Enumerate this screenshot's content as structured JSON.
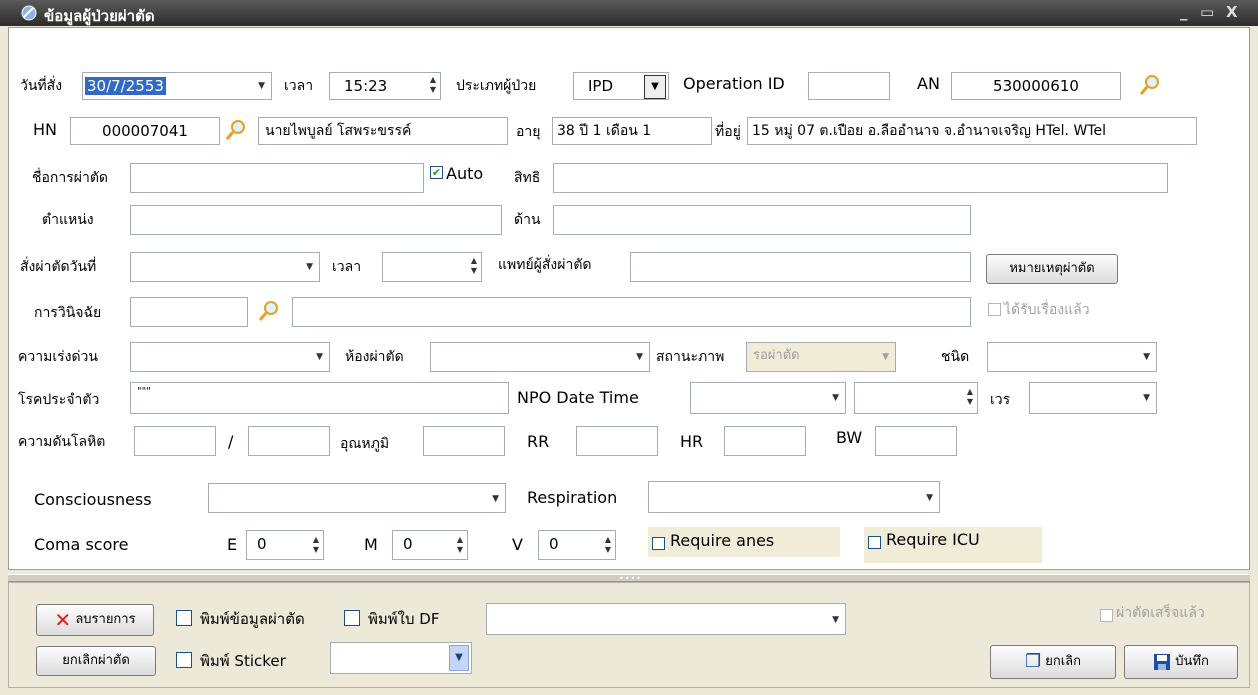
{
  "window": {
    "title": "ข้อมูลผู้ป่วยผ่าตัด",
    "controls": [
      "_",
      "▭",
      "X"
    ]
  },
  "form": {
    "order_date_label": "วันที่สั่ง",
    "order_date": "30/7/2553",
    "time_label": "เวลา",
    "time": "15:23",
    "patient_type_label": "ประเภทผู้ป่วย",
    "patient_type": "IPD",
    "operation_id_label": "Operation ID",
    "operation_id": "",
    "an_label": "AN",
    "an": "530000610",
    "hn_label": "HN",
    "hn": "000007041",
    "patient_name": "นายไพบูลย์ โสพระขรรค์",
    "age_label": "อายุ",
    "age": "38 ปี 1 เดือน 1",
    "address_label": "ที่อยู่",
    "address": "15 หมู่ 07 ต.เปือย อ.ลืออำนาจ จ.อำนาจเจริญ HTel. WTel",
    "operation_name_label": "ชื่อการผ่าตัด",
    "operation_name": "",
    "auto_label": "Auto",
    "auto_checked": true,
    "rights_label": "สิทธิ",
    "rights": "",
    "position_label": "ตำแหน่ง",
    "position": "",
    "side_label": "ด้าน",
    "side": "",
    "op_order_date_label": "สั่งผ่าตัดวันที่",
    "op_order_time_label": "เวลา",
    "ordering_doctor_label": "แพทย์ผู้สั่งผ่าตัด",
    "op_note_button": "หมายเหตุผ่าตัด",
    "diagnosis_label": "การวินิจฉัย",
    "received_label": "ได้รับเรื่องแล้ว",
    "urgency_label": "ความเร่งด่วน",
    "op_room_label": "ห้องผ่าตัด",
    "status_label": "สถานะภาพ",
    "status": "รอผ่าตัด",
    "type_label": "ชนิด",
    "underlying_label": "โรคประจำตัว",
    "underlying": "\"\"\"",
    "npo_label": "NPO Date Time",
    "shift_label": "เวร",
    "bp_label": "ความดันโลหิต",
    "slash": "/",
    "temp_label": "อุณหภูมิ",
    "rr_label": "RR",
    "hr_label": "HR",
    "bw_label": "BW",
    "consciousness_label": "Consciousness",
    "respiration_label": "Respiration",
    "coma_label": "Coma score",
    "e_label": "E",
    "e_value": "0",
    "m_label": "M",
    "m_value": "0",
    "v_label": "V",
    "v_value": "0",
    "require_anes_label": "Require anes",
    "require_icu_label": "Require ICU"
  },
  "bottom": {
    "delete_button": "ลบรายการ",
    "print_op_label": "พิมพ์ข้อมูลผ่าตัด",
    "print_df_label": "พิมพ์ใบ DF",
    "cancel_op_button": "ยกเลิกผ่าตัด",
    "print_sticker_label": "พิมพ์ Sticker",
    "op_done_label": "ผ่าตัดเสร็จแล้ว",
    "cancel_button": "ยกเลิก",
    "save_button": "บันทึก"
  },
  "colors": {
    "selection": "#316ac5",
    "titlebar": "#3a3a3a",
    "delete_icon": "#e02020",
    "save_icon": "#1c4fa0"
  }
}
